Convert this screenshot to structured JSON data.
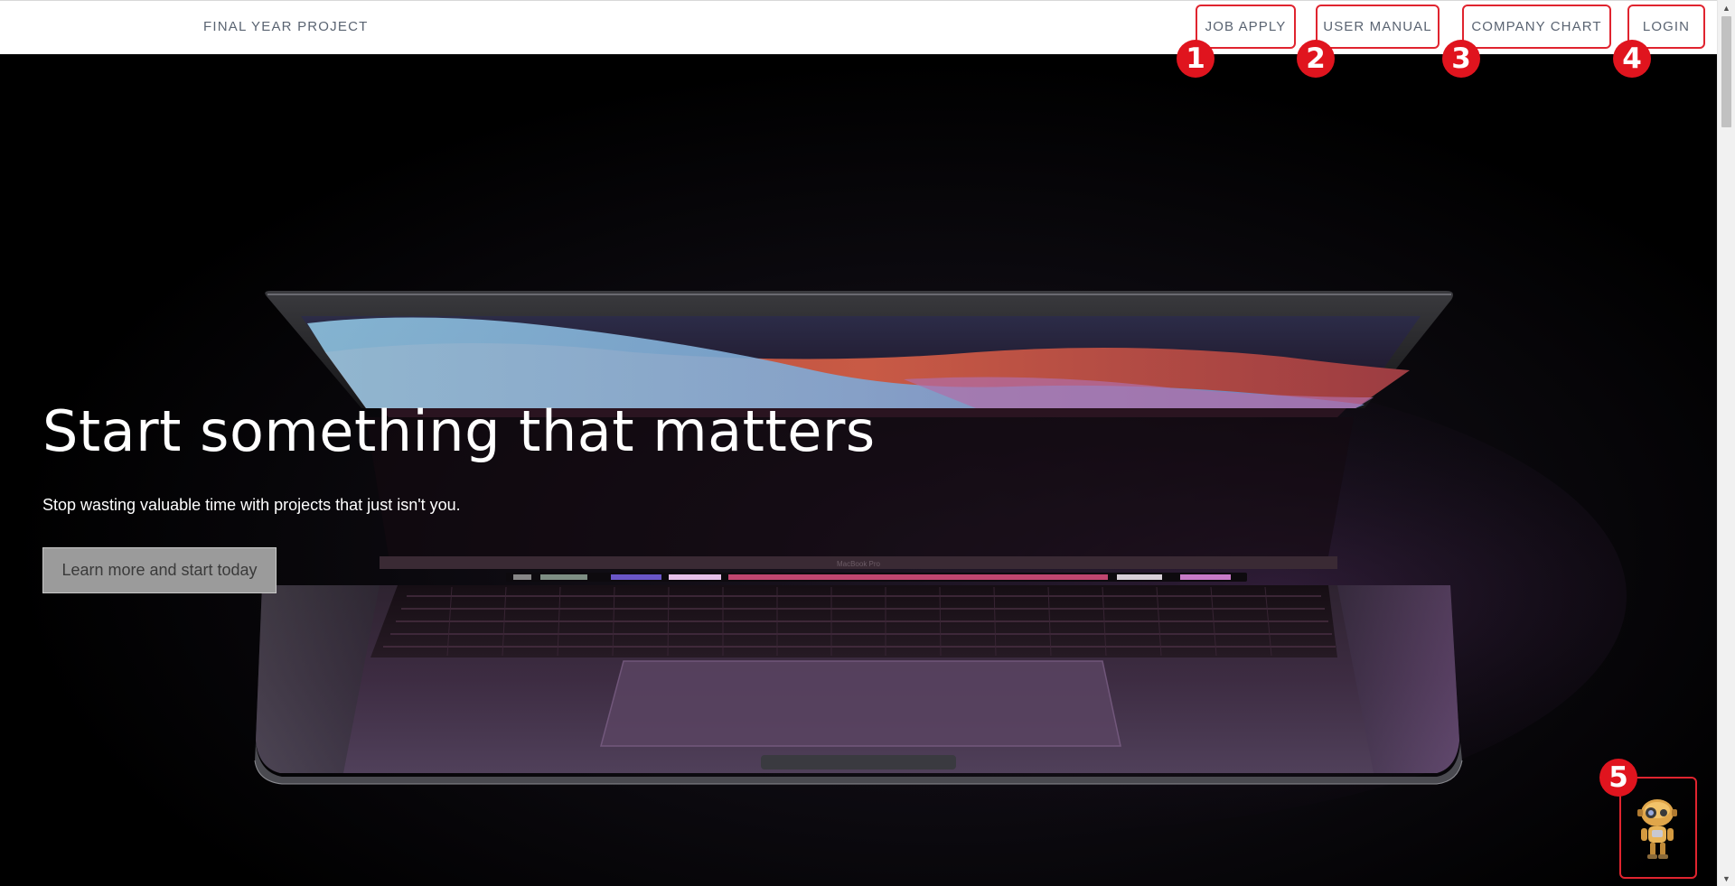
{
  "navbar": {
    "brand": "FINAL YEAR PROJECT",
    "items": [
      {
        "label": "JOB APPLY",
        "badge": "1"
      },
      {
        "label": "USER MANUAL",
        "badge": "2"
      },
      {
        "label": "COMPANY CHART",
        "badge": "3"
      },
      {
        "label": "LOGIN",
        "badge": "4"
      }
    ]
  },
  "hero": {
    "title": "Start something that matters",
    "subtitle": "Stop wasting valuable time with projects that just isn't you.",
    "cta_label": "Learn more and start today"
  },
  "chatbot": {
    "badge": "5",
    "icon": "robot-icon"
  },
  "colors": {
    "nav_text": "#5a6472",
    "highlight_border": "#e0242f",
    "badge_bg": "#e0141e",
    "hero_bg": "#000000",
    "cta_bg": "#9b9b9b"
  }
}
